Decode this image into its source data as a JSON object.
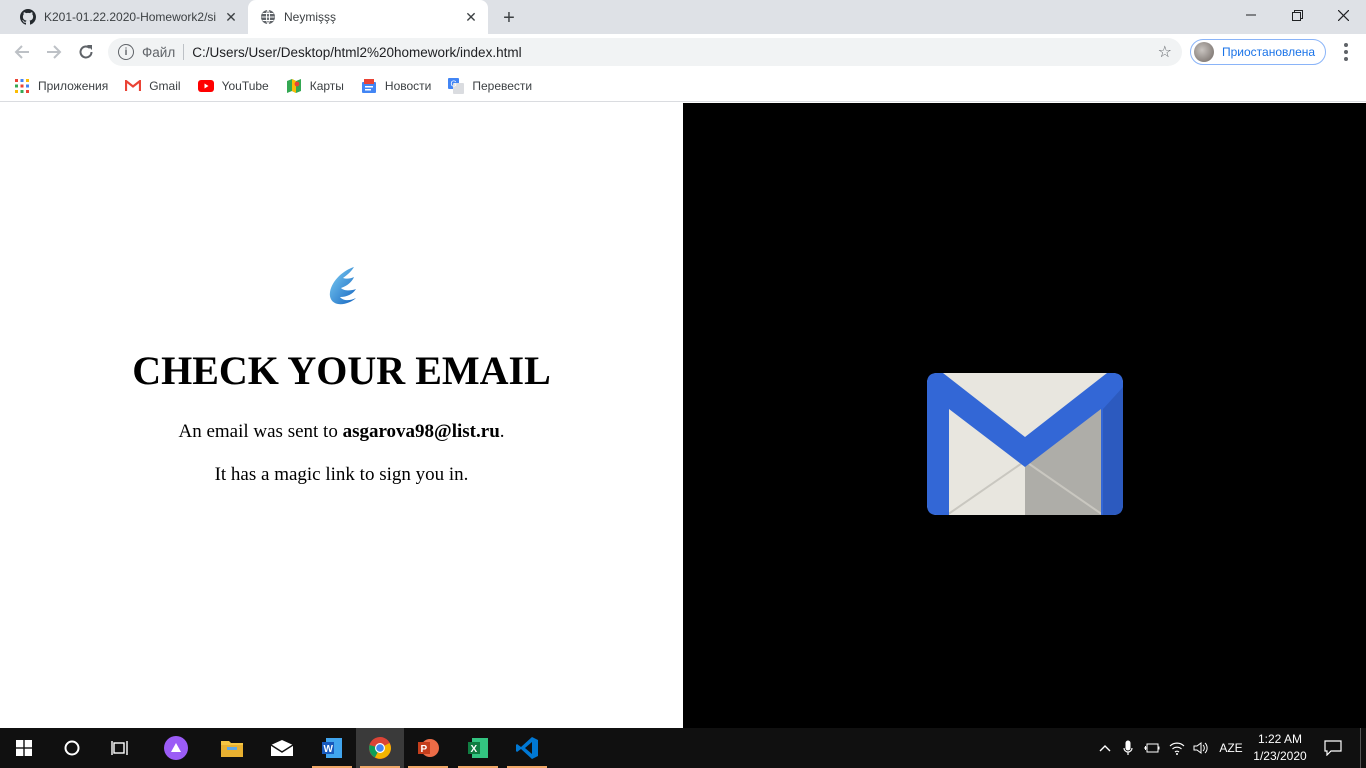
{
  "browser": {
    "tabs": [
      {
        "title": "K201-01.22.2020-Homework2/si",
        "icon": "github-icon",
        "active": false
      },
      {
        "title": "Neymişşş",
        "icon": "globe-icon",
        "active": true
      }
    ],
    "address": {
      "scheme_label": "Файл",
      "url": "C:/Users/User/Desktop/html2%20homework/index.html"
    },
    "profile_label": "Приостановлена",
    "bookmarks": [
      {
        "label": "Приложения",
        "icon": "apps-grid-icon"
      },
      {
        "label": "Gmail",
        "icon": "gmail-icon"
      },
      {
        "label": "YouTube",
        "icon": "youtube-icon"
      },
      {
        "label": "Карты",
        "icon": "maps-icon"
      },
      {
        "label": "Новости",
        "icon": "news-icon"
      },
      {
        "label": "Перевести",
        "icon": "translate-icon"
      }
    ]
  },
  "page": {
    "heading": "CHECK YOUR EMAIL",
    "sent_prefix": "An email was sent to ",
    "email": "asgarova98@list.ru",
    "sent_suffix": ".",
    "magic_link": "It has a magic link to sign you in.",
    "colors": {
      "left_bg": "#ffffff",
      "right_bg": "#000000",
      "envelope_blue": "#3367d6",
      "envelope_paper": "#e8e6df"
    }
  },
  "taskbar": {
    "apps": [
      "start-icon",
      "cortana-icon",
      "task-view-icon",
      "alice-icon",
      "file-explorer-icon",
      "mail-icon",
      "word-icon",
      "chrome-icon",
      "powerpoint-icon",
      "excel-icon",
      "vscode-icon"
    ],
    "language": "AZE",
    "time": "1:22 AM",
    "date": "1/23/2020"
  }
}
